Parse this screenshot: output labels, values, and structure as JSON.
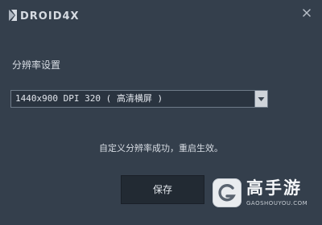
{
  "window": {
    "logo_text": "DROID4X",
    "close_icon": "close-icon"
  },
  "settings": {
    "resolution_label": "分辨率设置",
    "resolution_value": "1440x900 DPI 320 ( 高清横屏 )",
    "dropdown_icon": "triangle-down-icon",
    "status_message": "自定义分辨率成功，重启生效。",
    "save_label": "保存"
  },
  "watermark": {
    "title": "高手游",
    "subtitle": "GAOSHOUYOU.COM",
    "icon": "g-logo-icon"
  },
  "colors": {
    "background": "#343f4c",
    "button": "#222a33",
    "text": "#d7dce3"
  }
}
